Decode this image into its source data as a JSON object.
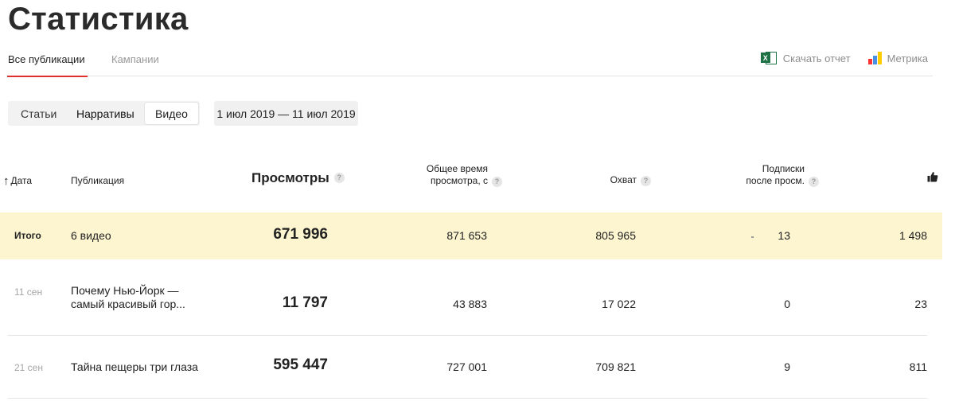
{
  "page": {
    "title": "Статистика"
  },
  "tabs": [
    {
      "label": "Все публикации",
      "active": true
    },
    {
      "label": "Кампании",
      "active": false
    }
  ],
  "tools": {
    "download_report": "Скачать отчет",
    "metrika": "Метрика"
  },
  "filters": {
    "segments": [
      {
        "label": "Статьи",
        "selected": false
      },
      {
        "label": "Нарративы",
        "selected": false
      },
      {
        "label": "Видео",
        "selected": true
      }
    ],
    "date_range": "1 июл 2019 — 11 июл 2019"
  },
  "table": {
    "columns": {
      "date": "Дата",
      "publication": "Публикация",
      "views": "Просмотры",
      "total_time_line1": "Общее время",
      "total_time_line2": "просмотра, с",
      "reach": "Охват",
      "subs_line1": "Подписки",
      "subs_line2": "после просм.",
      "likes_icon": "thumbs-up-icon"
    },
    "total": {
      "label": "Итого",
      "publication": "6 видео",
      "views": "671 996",
      "total_time": "871 653",
      "reach": "805 965",
      "subscriptions": "13",
      "likes": "1 498"
    },
    "rows": [
      {
        "date": "11 сен",
        "publication": "Почему Нью-Йорк — самый красивый гор...",
        "views": "11 797",
        "total_time": "43 883",
        "reach": "17 022",
        "subscriptions": "0",
        "likes": "23"
      },
      {
        "date": "21 сен",
        "publication": "Тайна пещеры три глаза",
        "views": "595 447",
        "total_time": "727 001",
        "reach": "709 821",
        "subscriptions": "9",
        "likes": "811"
      }
    ]
  },
  "colors": {
    "accent_red": "#e0302b",
    "total_row_bg": "#fdf5d0",
    "excel_green": "#1e7145"
  }
}
